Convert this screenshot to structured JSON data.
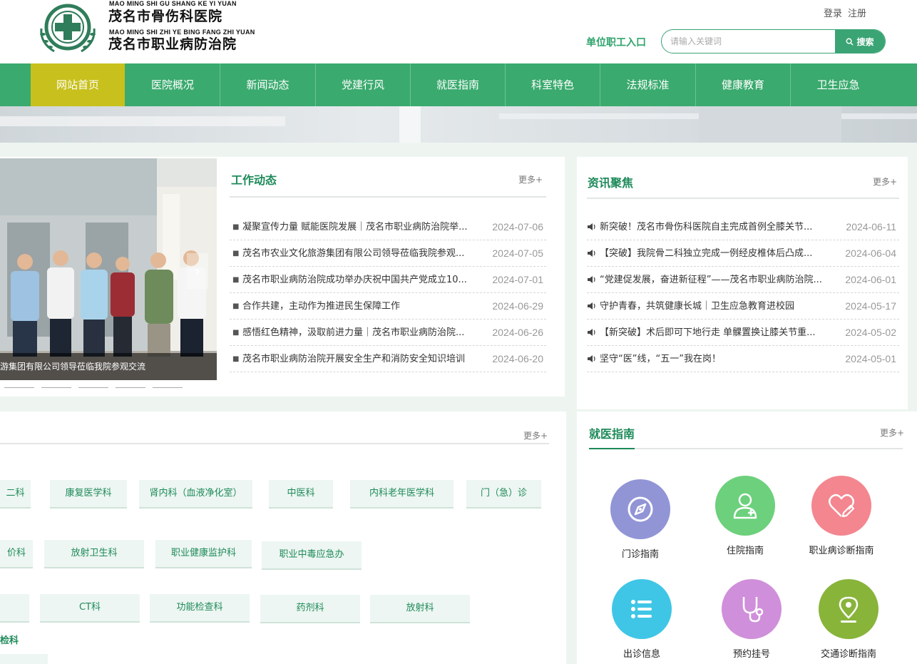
{
  "header": {
    "pinyin_1": "MAO MING SHI GU SHANG KE YI YUAN",
    "name_1": "茂名市骨伤科医院",
    "pinyin_2": "MAO MING SHI ZHI YE BING FANG ZHI YUAN",
    "name_2": "茂名市职业病防治院",
    "login": "登录",
    "register": "注册",
    "staff_entry": "单位职工入口",
    "search_placeholder": "请输入关键词",
    "search_button": "搜索"
  },
  "nav": [
    {
      "label": "网站首页"
    },
    {
      "label": "医院概况"
    },
    {
      "label": "新闻动态"
    },
    {
      "label": "党建行风"
    },
    {
      "label": "就医指南"
    },
    {
      "label": "科室特色"
    },
    {
      "label": "法规标准"
    },
    {
      "label": "健康教育"
    },
    {
      "label": "卫生应急"
    }
  ],
  "work": {
    "title": "工作动态",
    "more": "更多+",
    "photo_caption": "游集团有限公司领导莅临我院参观交流",
    "items": [
      {
        "title": "凝聚宣传力量 赋能医院发展｜茂名市职业病防治院举...",
        "date": "2024-07-06"
      },
      {
        "title": "茂名市农业文化旅游集团有限公司领导莅临我院参观...",
        "date": "2024-07-05"
      },
      {
        "title": "茂名市职业病防治院成功举办庆祝中国共产党成立10...",
        "date": "2024-07-01"
      },
      {
        "title": "合作共建，主动作为推进民生保障工作",
        "date": "2024-06-29"
      },
      {
        "title": "感悟红色精神，汲取前进力量｜茂名市职业病防治院...",
        "date": "2024-06-26"
      },
      {
        "title": "茂名市职业病防治院开展安全生产和消防安全知识培训",
        "date": "2024-06-20"
      }
    ]
  },
  "news": {
    "title": "资讯聚焦",
    "more": "更多+",
    "items": [
      {
        "title": "新突破！茂名市骨伤科医院自主完成首例全膝关节...",
        "date": "2024-06-11"
      },
      {
        "title": "【突破】我院骨二科独立完成一例经皮椎体后凸成...",
        "date": "2024-06-04"
      },
      {
        "title": "“党建促发展，奋进新征程”——茂名市职业病防治院...",
        "date": "2024-06-01"
      },
      {
        "title": "守护青春，共筑健康长城｜卫生应急教育进校园",
        "date": "2024-05-17"
      },
      {
        "title": "【新突破】术后即可下地行走 单髁置换让膝关节重...",
        "date": "2024-05-02"
      },
      {
        "title": "坚守“医”线，“五一”我在岗！",
        "date": "2024-05-01"
      }
    ]
  },
  "departments": {
    "more": "更多+",
    "row1": [
      "二科",
      "康复医学科",
      "肾内科（血液净化室）",
      "中医科",
      "内科老年医学科",
      "门（急）诊"
    ],
    "row2": [
      "价科",
      "放射卫生科",
      "职业健康监护科",
      "职业中毒应急办"
    ],
    "row3": [
      "",
      "CT科",
      "功能检查科",
      "药剂科",
      "放射科"
    ],
    "row4_label": "检科"
  },
  "guide": {
    "title": "就医指南",
    "more": "更多+",
    "items": [
      {
        "label": "门诊指南",
        "icon": "compass-icon",
        "color": "#9195d6"
      },
      {
        "label": "住院指南",
        "icon": "nurse-icon",
        "color": "#6cd07c"
      },
      {
        "label": "职业病诊断指南",
        "icon": "heart-pen-icon",
        "color": "#f3868f"
      },
      {
        "label": "出诊信息",
        "icon": "list-icon",
        "color": "#3fc6e6"
      },
      {
        "label": "预约挂号",
        "icon": "stethoscope-icon",
        "color": "#d08fda"
      },
      {
        "label": "交通诊断指南",
        "icon": "location-pin-icon",
        "color": "#88b43a"
      }
    ]
  }
}
